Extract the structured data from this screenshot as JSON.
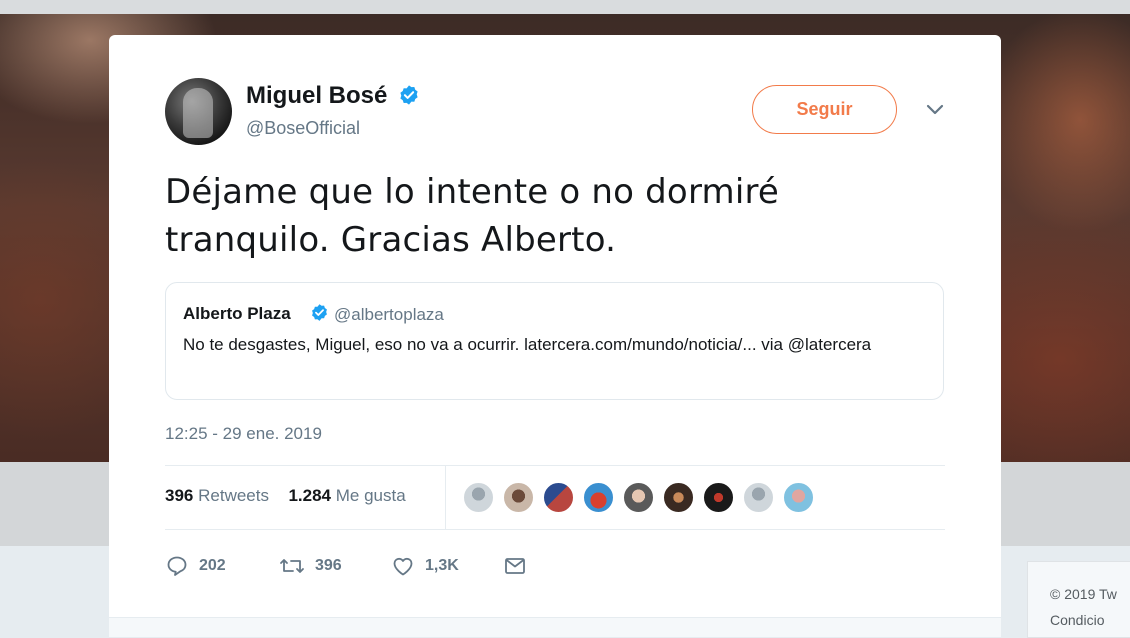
{
  "tweet": {
    "author_name": "Miguel Bosé",
    "author_handle": "@BoseOfficial",
    "follow_label": "Seguir",
    "text": "Déjame que lo intente o no dormiré tranquilo. Gracias Alberto.",
    "timestamp": "12:25 - 29 ene. 2019"
  },
  "quoted": {
    "author_name": "Alberto Plaza",
    "author_handle": "@albertoplaza",
    "text": "No te desgastes, Miguel, eso no va a ocurrir. latercera.com/mundo/noticia/... via @latercera"
  },
  "stats": {
    "retweets_count": "396",
    "retweets_label": "Retweets",
    "likes_count": "1.284",
    "likes_label": "Me gusta"
  },
  "actions": {
    "replies": "202",
    "retweets": "396",
    "likes": "1,3K"
  },
  "footer": {
    "copyright": "© 2019 Tw",
    "conditions": "Condicio"
  },
  "colors": {
    "accent": "#f27b4a",
    "verified": "#1da1f2",
    "muted": "#657786",
    "text": "#14171a"
  },
  "icons": [
    "verified-badge-icon",
    "chevron-down-icon",
    "reply-icon",
    "retweet-icon",
    "like-icon",
    "message-icon"
  ]
}
